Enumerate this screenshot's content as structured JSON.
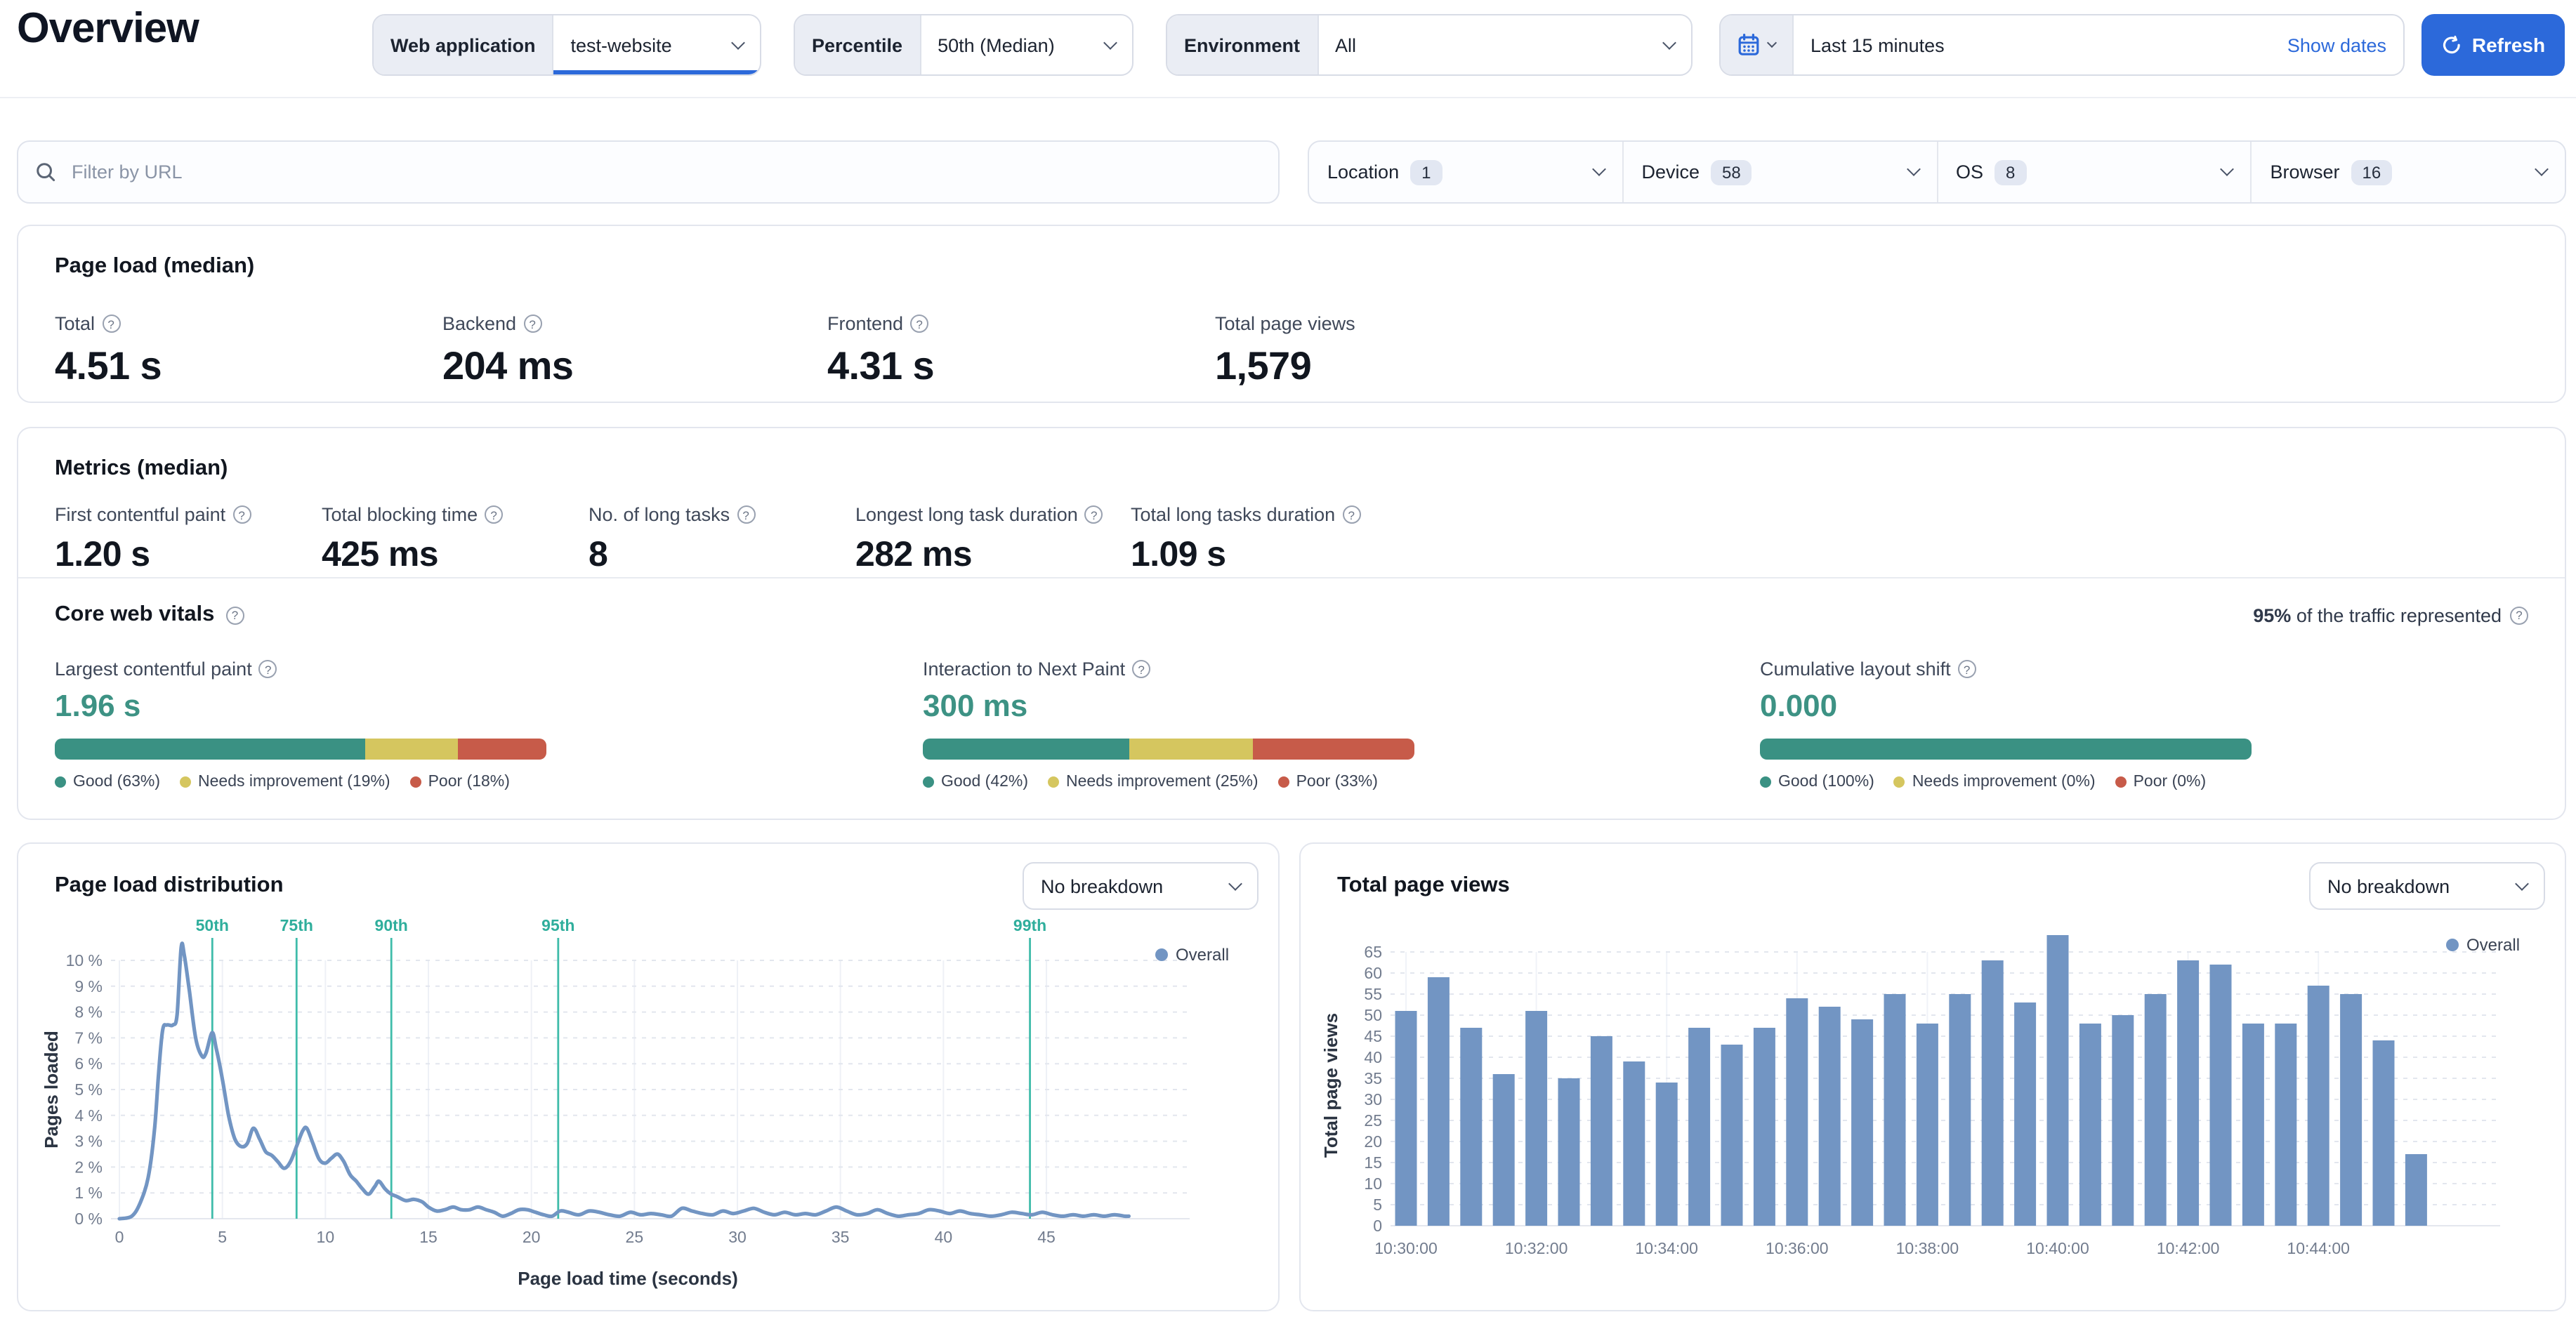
{
  "page": {
    "title": "Overview"
  },
  "header": {
    "web_application": {
      "label": "Web application",
      "value": "test-website"
    },
    "percentile": {
      "label": "Percentile",
      "value": "50th (Median)"
    },
    "environment": {
      "label": "Environment",
      "value": "All"
    },
    "date_range": {
      "value": "Last 15 minutes",
      "show_dates_label": "Show dates"
    },
    "refresh_label": "Refresh"
  },
  "filters": {
    "search_placeholder": "Filter by URL",
    "facets": [
      {
        "label": "Location",
        "count": "1"
      },
      {
        "label": "Device",
        "count": "58"
      },
      {
        "label": "OS",
        "count": "8"
      },
      {
        "label": "Browser",
        "count": "16"
      }
    ]
  },
  "colors": {
    "accent_blue": "#2c69da",
    "chart_blue": "#7295c3",
    "value_teal": "#3d9284",
    "good": "#3a9183",
    "needs_improvement": "#d5c65f",
    "poor": "#c75b49",
    "percentile_line": "#3fbcaa"
  },
  "cards": {
    "page_load": {
      "title": "Page load (median)",
      "metrics": [
        {
          "label": "Total",
          "value": "4.51 s"
        },
        {
          "label": "Backend",
          "value": "204 ms"
        },
        {
          "label": "Frontend",
          "value": "4.31 s"
        },
        {
          "label": "Total page views",
          "value": "1,579"
        }
      ]
    },
    "metrics": {
      "title": "Metrics (median)",
      "metrics": [
        {
          "label": "First contentful paint",
          "value": "1.20 s"
        },
        {
          "label": "Total blocking time",
          "value": "425 ms"
        },
        {
          "label": "No. of long tasks",
          "value": "8"
        },
        {
          "label": "Longest long task duration",
          "value": "282 ms"
        },
        {
          "label": "Total long tasks duration",
          "value": "1.09 s"
        }
      ],
      "core_web_vitals": {
        "title": "Core web vitals",
        "traffic_strong": "95%",
        "traffic_rest": " of the traffic represented",
        "vitals": [
          {
            "label": "Largest contentful paint",
            "value": "1.96 s",
            "good": 63,
            "needs": 19,
            "poor": 18,
            "legend": [
              "Good (63%)",
              "Needs improvement (19%)",
              "Poor (18%)"
            ]
          },
          {
            "label": "Interaction to Next Paint",
            "value": "300 ms",
            "good": 42,
            "needs": 25,
            "poor": 33,
            "legend": [
              "Good (42%)",
              "Needs improvement (25%)",
              "Poor (33%)"
            ]
          },
          {
            "label": "Cumulative layout shift",
            "value": "0.000",
            "good": 100,
            "needs": 0,
            "poor": 0,
            "legend": [
              "Good (100%)",
              "Needs improvement (0%)",
              "Poor (0%)"
            ]
          }
        ]
      }
    }
  },
  "chart_data": [
    {
      "type": "line",
      "title": "Page load distribution",
      "breakdown_label": "No breakdown",
      "legend": [
        "Overall"
      ],
      "xlabel": "Page load time (seconds)",
      "ylabel": "Pages loaded",
      "xlim": [
        0,
        49
      ],
      "ylim": [
        0,
        10.5
      ],
      "x_ticks": [
        0,
        5,
        10,
        15,
        20,
        25,
        30,
        35,
        40,
        45
      ],
      "y_ticks_percent": [
        0,
        1,
        2,
        3,
        4,
        5,
        6,
        7,
        8,
        9,
        10
      ],
      "grid": true,
      "legend_position": "top-right",
      "percentiles": [
        {
          "label": "50th",
          "t": 4.51
        },
        {
          "label": "75th",
          "t": 8.6
        },
        {
          "label": "90th",
          "t": 13.2
        },
        {
          "label": "95th",
          "t": 21.3
        },
        {
          "label": "99th",
          "t": 44.2
        }
      ],
      "points": [
        [
          0,
          0
        ],
        [
          0.6,
          0.1
        ],
        [
          1,
          0.6
        ],
        [
          1.4,
          1.6
        ],
        [
          1.7,
          3.4
        ],
        [
          1.9,
          5.6
        ],
        [
          2.1,
          7.3
        ],
        [
          2.3,
          7.5
        ],
        [
          2.6,
          7.5
        ],
        [
          2.8,
          7.9
        ],
        [
          3,
          10.5
        ],
        [
          3.15,
          10.2
        ],
        [
          3.4,
          8.8
        ],
        [
          3.7,
          7.0
        ],
        [
          4,
          6.3
        ],
        [
          4.2,
          6.4
        ],
        [
          4.5,
          7.2
        ],
        [
          4.7,
          6.6
        ],
        [
          5,
          5.4
        ],
        [
          5.3,
          4.0
        ],
        [
          5.6,
          3.1
        ],
        [
          5.9,
          2.8
        ],
        [
          6.2,
          2.9
        ],
        [
          6.5,
          3.5
        ],
        [
          6.8,
          3.1
        ],
        [
          7.1,
          2.6
        ],
        [
          7.4,
          2.45
        ],
        [
          7.7,
          2.2
        ],
        [
          8,
          1.95
        ],
        [
          8.3,
          2.2
        ],
        [
          8.6,
          2.8
        ],
        [
          8.9,
          3.4
        ],
        [
          9.1,
          3.5
        ],
        [
          9.4,
          2.9
        ],
        [
          9.7,
          2.3
        ],
        [
          10,
          2.15
        ],
        [
          10.3,
          2.35
        ],
        [
          10.6,
          2.5
        ],
        [
          10.9,
          2.2
        ],
        [
          11.2,
          1.7
        ],
        [
          11.5,
          1.45
        ],
        [
          11.8,
          1.15
        ],
        [
          12.1,
          0.95
        ],
        [
          12.4,
          1.25
        ],
        [
          12.6,
          1.45
        ],
        [
          12.9,
          1.15
        ],
        [
          13.2,
          0.95
        ],
        [
          13.5,
          0.85
        ],
        [
          13.9,
          0.7
        ],
        [
          14.3,
          0.75
        ],
        [
          14.7,
          0.65
        ],
        [
          15,
          0.45
        ],
        [
          15.4,
          0.3
        ],
        [
          15.8,
          0.35
        ],
        [
          16.2,
          0.45
        ],
        [
          16.6,
          0.35
        ],
        [
          17,
          0.35
        ],
        [
          17.4,
          0.45
        ],
        [
          17.8,
          0.35
        ],
        [
          18.2,
          0.25
        ],
        [
          18.6,
          0.1
        ],
        [
          19,
          0.2
        ],
        [
          19.4,
          0.35
        ],
        [
          19.8,
          0.35
        ],
        [
          20.2,
          0.25
        ],
        [
          20.6,
          0.15
        ],
        [
          21,
          0.1
        ],
        [
          21.4,
          0.3
        ],
        [
          21.8,
          0.25
        ],
        [
          22.3,
          0.15
        ],
        [
          22.8,
          0.3
        ],
        [
          23.3,
          0.25
        ],
        [
          23.8,
          0.15
        ],
        [
          24.3,
          0.1
        ],
        [
          24.8,
          0.25
        ],
        [
          25.3,
          0.15
        ],
        [
          25.8,
          0.2
        ],
        [
          26.3,
          0.15
        ],
        [
          26.8,
          0.1
        ],
        [
          27.3,
          0.4
        ],
        [
          27.8,
          0.3
        ],
        [
          28.3,
          0.2
        ],
        [
          28.8,
          0.15
        ],
        [
          29.3,
          0.3
        ],
        [
          29.8,
          0.2
        ],
        [
          30.3,
          0.3
        ],
        [
          30.8,
          0.4
        ],
        [
          31.3,
          0.25
        ],
        [
          31.8,
          0.15
        ],
        [
          32.3,
          0.25
        ],
        [
          32.8,
          0.15
        ],
        [
          33.3,
          0.2
        ],
        [
          33.8,
          0.15
        ],
        [
          34.3,
          0.3
        ],
        [
          34.8,
          0.45
        ],
        [
          35.3,
          0.3
        ],
        [
          35.8,
          0.15
        ],
        [
          36.3,
          0.2
        ],
        [
          36.8,
          0.35
        ],
        [
          37.3,
          0.2
        ],
        [
          37.8,
          0.1
        ],
        [
          38.3,
          0.15
        ],
        [
          38.8,
          0.2
        ],
        [
          39.3,
          0.35
        ],
        [
          39.8,
          0.3
        ],
        [
          40.3,
          0.2
        ],
        [
          40.8,
          0.3
        ],
        [
          41.3,
          0.2
        ],
        [
          41.8,
          0.15
        ],
        [
          42.3,
          0.1
        ],
        [
          42.8,
          0.15
        ],
        [
          43.3,
          0.25
        ],
        [
          43.8,
          0.2
        ],
        [
          44.3,
          0.15
        ],
        [
          44.8,
          0.25
        ],
        [
          45.3,
          0.15
        ],
        [
          45.8,
          0.1
        ],
        [
          46.3,
          0.15
        ],
        [
          46.8,
          0.1
        ],
        [
          47.3,
          0.15
        ],
        [
          47.8,
          0.1
        ],
        [
          48.3,
          0.15
        ],
        [
          48.8,
          0.1
        ],
        [
          49,
          0.1
        ]
      ]
    },
    {
      "type": "bar",
      "title": "Total page views",
      "breakdown_label": "No breakdown",
      "legend": [
        "Overall"
      ],
      "ylabel": "Total page views",
      "ylim": [
        0,
        69
      ],
      "y_tick_step": 5,
      "y_max_tick": 65,
      "grid": true,
      "legend_position": "top-right",
      "start_time": "10:30:00",
      "interval_seconds": 30,
      "x_tick_labels": [
        "10:30:00",
        "10:32:00",
        "10:34:00",
        "10:36:00",
        "10:38:00",
        "10:40:00",
        "10:42:00",
        "10:44:00"
      ],
      "values": [
        51,
        59,
        47,
        36,
        51,
        35,
        45,
        39,
        34,
        47,
        43,
        47,
        54,
        52,
        49,
        55,
        48,
        55,
        63,
        53,
        69,
        48,
        50,
        55,
        63,
        62,
        48,
        48,
        57,
        55,
        44,
        17
      ]
    }
  ]
}
